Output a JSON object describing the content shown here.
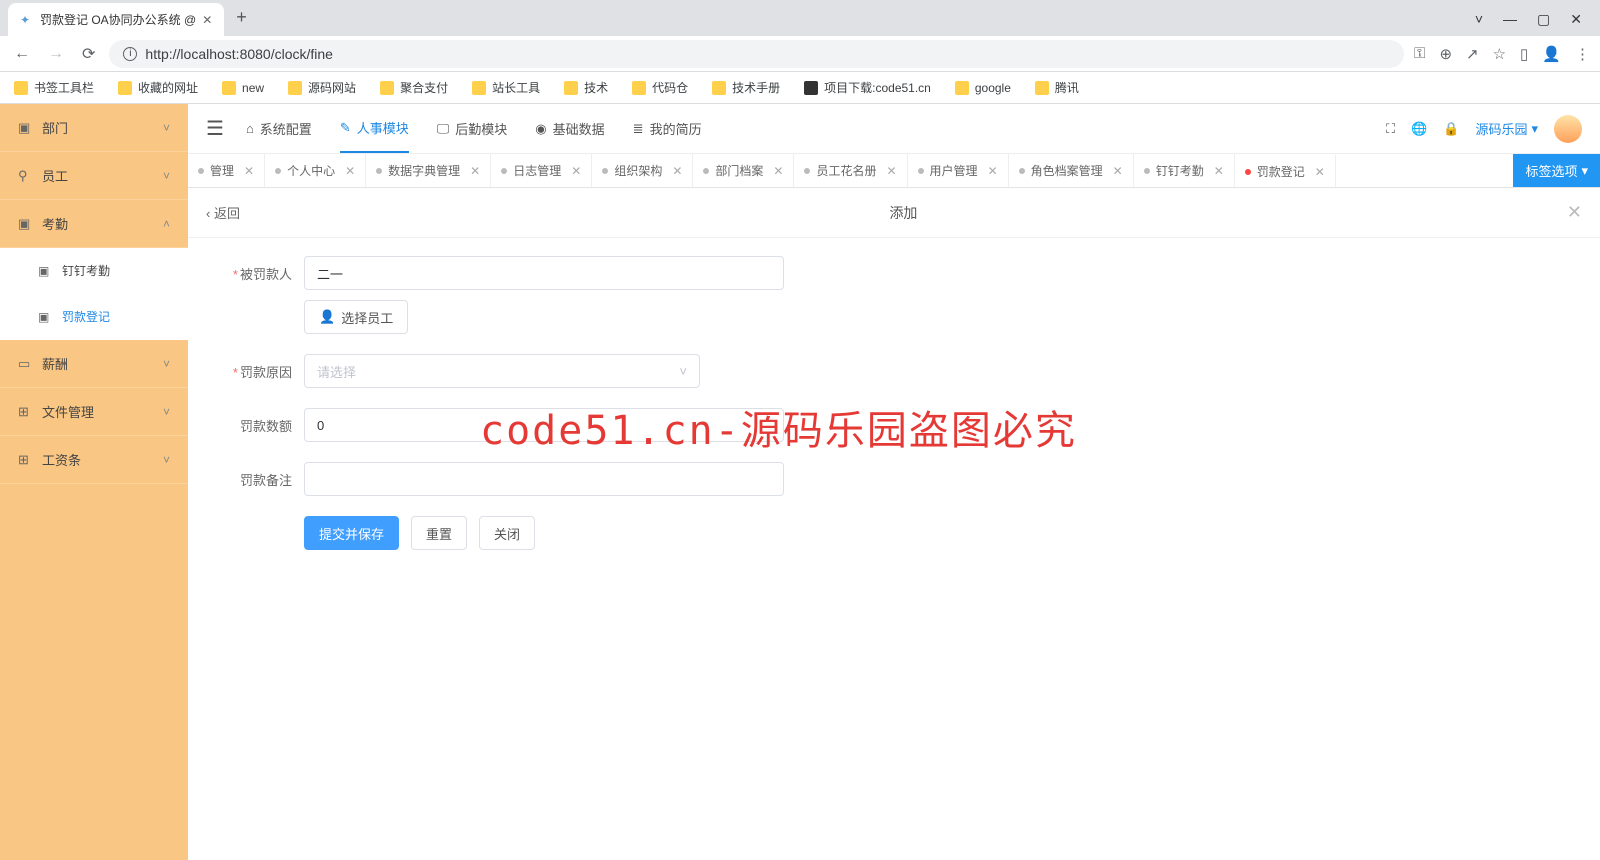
{
  "browser": {
    "tab_title": "罚款登记 OA协同办公系统 @",
    "url": "http://localhost:8080/clock/fine",
    "bookmarks": [
      "书签工具栏",
      "收藏的网址",
      "new",
      "源码网站",
      "聚合支付",
      "站长工具",
      "技术",
      "代码仓",
      "技术手册",
      "项目下载:code51.cn",
      "google",
      "腾讯"
    ]
  },
  "sidebar": {
    "items": [
      {
        "icon": "▣",
        "label": "部门",
        "expand": "˅"
      },
      {
        "icon": "⚲",
        "label": "员工",
        "expand": "˅"
      },
      {
        "icon": "▣",
        "label": "考勤",
        "expand": "˄",
        "children": [
          {
            "icon": "▣",
            "label": "钉钉考勤"
          },
          {
            "icon": "▣",
            "label": "罚款登记",
            "active": true
          }
        ]
      },
      {
        "icon": "▭",
        "label": "薪酬",
        "expand": "˅"
      },
      {
        "icon": "⊞",
        "label": "文件管理",
        "expand": "˅"
      },
      {
        "icon": "⊞",
        "label": "工资条",
        "expand": "˅"
      }
    ]
  },
  "topnav": {
    "items": [
      {
        "icon": "⌂",
        "label": "系统配置"
      },
      {
        "icon": "✎",
        "label": "人事模块",
        "active": true
      },
      {
        "icon": "🖵",
        "label": "后勤模块"
      },
      {
        "icon": "◉",
        "label": "基础数据"
      },
      {
        "icon": "≣",
        "label": "我的简历"
      }
    ],
    "user": "源码乐园"
  },
  "tabs": {
    "items": [
      "管理",
      "个人中心",
      "数据字典管理",
      "日志管理",
      "组织架构",
      "部门档案",
      "员工花名册",
      "用户管理",
      "角色档案管理",
      "钉钉考勤"
    ],
    "active": "罚款登记",
    "opts": "标签选项"
  },
  "form": {
    "back": "返回",
    "title": "添加",
    "fields": {
      "penalized_person": {
        "label": "被罚款人",
        "value": "二一",
        "required": true,
        "select_btn": "选择员工"
      },
      "reason": {
        "label": "罚款原因",
        "placeholder": "请选择",
        "required": true
      },
      "amount": {
        "label": "罚款数额",
        "value": "0"
      },
      "remark": {
        "label": "罚款备注",
        "value": ""
      }
    },
    "buttons": {
      "submit": "提交并保存",
      "reset": "重置",
      "close": "关闭"
    }
  },
  "watermark": "code51.cn-源码乐园盗图必究"
}
